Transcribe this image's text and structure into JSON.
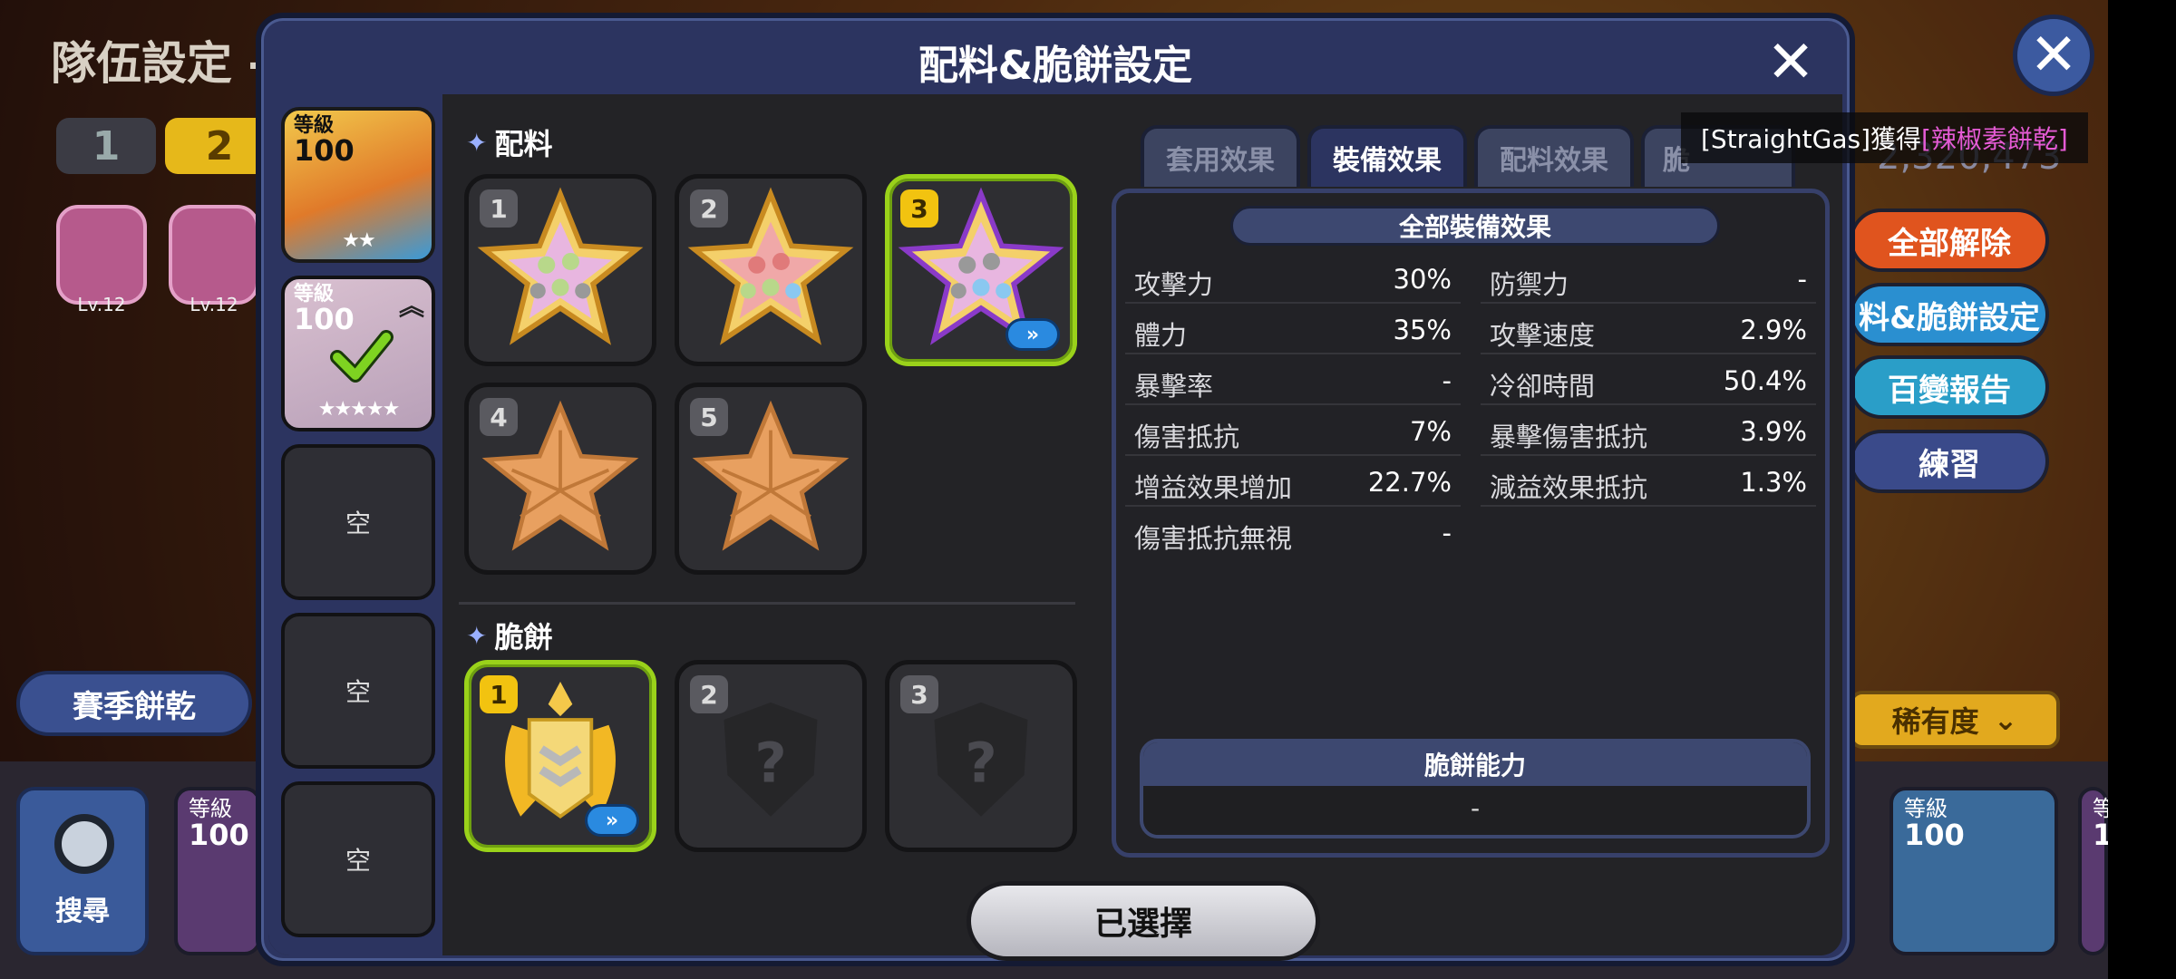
{
  "background": {
    "title": "隊伍設定 -",
    "team_tabs": [
      "1",
      "2"
    ],
    "pets": [
      {
        "level": "Lv.12"
      },
      {
        "level": "Lv.12"
      }
    ],
    "season_button": "賽季餅乾",
    "search_button": "搜尋",
    "score": "2,320,473",
    "right_buttons": [
      "全部解除",
      "料&脆餅設定",
      "百變報告",
      "練習"
    ],
    "rarity_button": "稀有度",
    "bottom_cards": [
      {
        "level_label": "等級",
        "level": "100"
      },
      {
        "level_label": "等級",
        "level": "100"
      },
      {
        "level_label": "等",
        "level": "1"
      }
    ],
    "colors": {
      "accent_yellow": "#e6b81a",
      "blue": "#3c5aa0",
      "red": "#e0541e"
    }
  },
  "modal": {
    "title": "配料&脆餅設定",
    "close_icon": "close-icon",
    "cookies": [
      {
        "level_label": "等級",
        "level": "100",
        "state": "active"
      },
      {
        "level_label": "等級",
        "level": "100",
        "state": "done"
      },
      {
        "empty_label": "空"
      },
      {
        "empty_label": "空"
      },
      {
        "empty_label": "空"
      }
    ],
    "toppings_header": "配料",
    "topping_slots": [
      {
        "num": "1",
        "filled": true
      },
      {
        "num": "2",
        "filled": true
      },
      {
        "num": "3",
        "filled": true,
        "selected": true
      },
      {
        "num": "4",
        "filled": false
      },
      {
        "num": "5",
        "filled": false
      }
    ],
    "biscuits_header": "脆餅",
    "biscuit_slots": [
      {
        "num": "1",
        "filled": true,
        "selected": true
      },
      {
        "num": "2",
        "filled": false
      },
      {
        "num": "3",
        "filled": false
      }
    ],
    "tabs": [
      "套用效果",
      "裝備效果",
      "配料效果",
      "脆"
    ],
    "active_tab": "裝備效果",
    "panel_title": "全部裝備效果",
    "stats_left": [
      {
        "name": "攻擊力",
        "value": "30%"
      },
      {
        "name": "體力",
        "value": "35%"
      },
      {
        "name": "暴擊率",
        "value": "-"
      },
      {
        "name": "傷害抵抗",
        "value": "7%"
      },
      {
        "name": "增益效果增加",
        "value": "22.7%"
      },
      {
        "name": "傷害抵抗無視",
        "value": "-"
      }
    ],
    "stats_right": [
      {
        "name": "防禦力",
        "value": "-"
      },
      {
        "name": "攻擊速度",
        "value": "2.9%"
      },
      {
        "name": "冷卻時間",
        "value": "50.4%"
      },
      {
        "name": "暴擊傷害抵抗",
        "value": "3.9%"
      },
      {
        "name": "減益效果抵抗",
        "value": "1.3%"
      }
    ],
    "biscuit_ability_title": "脆餅能力",
    "biscuit_ability_value": "-",
    "select_button": "已選擇"
  },
  "toast": {
    "prefix": "[StraightGas]獲得",
    "item": "[辣椒素餅乾]"
  }
}
